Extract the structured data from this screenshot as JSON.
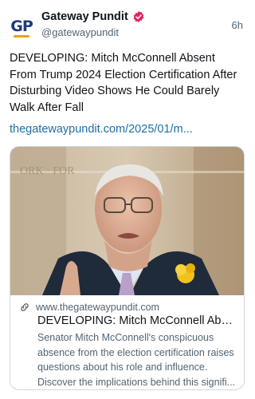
{
  "author": {
    "avatar_text": "GP",
    "display_name": "Gateway Pundit",
    "handle": "@gatewaypundit",
    "verified": true,
    "verified_color": "#e0245e"
  },
  "post": {
    "timestamp": "6h",
    "text": "DEVELOPING: Mitch McConnell Absent From Trump 2024 Election Certification After Disturbing Video Shows He Could Barely Walk After Fall",
    "link_text": "thegatewaypundit.com/2025/01/m..."
  },
  "link_card": {
    "image_alt": "Mitch McConnell speaking, wearing glasses, dark suit with yellow flower boutonniere",
    "domain": "www.thegatewaypundit.com",
    "title": "DEVELOPING: Mitch McConnell Abse...",
    "description_lines": [
      "Senator Mitch McConnell's conspicuous",
      "absence from the election certification raises",
      "questions about his role and influence.",
      "Discover the implications behind this signifi..."
    ]
  },
  "colors": {
    "link": "#1d6fa5",
    "secondary_text": "#536471",
    "border": "#cfd9de"
  }
}
